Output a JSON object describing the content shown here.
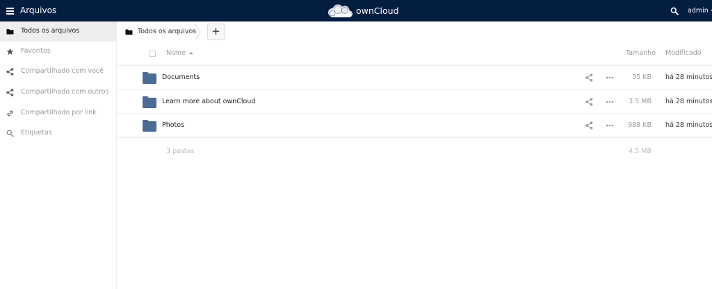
{
  "header": {
    "app_name": "Arquivos",
    "brand": "ownCloud",
    "user": "admin",
    "background_color": "#041e42"
  },
  "sidebar": {
    "items": [
      {
        "label": "Todos os arquivos",
        "icon": "folder-icon",
        "active": true
      },
      {
        "label": "Favoritos",
        "icon": "star-icon",
        "active": false
      },
      {
        "label": "Compartilhado com você",
        "icon": "share-icon",
        "active": false
      },
      {
        "label": "Compartilhado com outros",
        "icon": "share-icon",
        "active": false
      },
      {
        "label": "Compartilhado por link",
        "icon": "link-icon",
        "active": false
      },
      {
        "label": "Etiquetas",
        "icon": "search-icon",
        "active": false
      }
    ]
  },
  "breadcrumb": {
    "label": "Todos os arquivos",
    "new_label": "+"
  },
  "table": {
    "columns": {
      "name": "Nome",
      "size": "Tamanho",
      "modified": "Modificado"
    },
    "rows": [
      {
        "name": "Documents",
        "size": "35 KB",
        "modified": "há 28 minutos"
      },
      {
        "name": "Learn more about ownCloud",
        "size": "3.5 MB",
        "modified": "há 28 minutos"
      },
      {
        "name": "Photos",
        "size": "988 KB",
        "modified": "há 28 minutos"
      }
    ],
    "summary": {
      "count": "3 pastas",
      "size": "4.5 MB"
    },
    "folder_color": "#4a6b96"
  }
}
